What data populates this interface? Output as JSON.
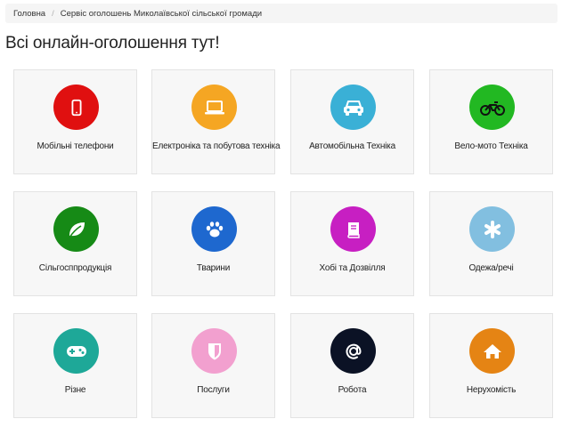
{
  "breadcrumb": {
    "home": "Головна",
    "separator": "/",
    "current": "Сервіс оголошень Миколаївської сільської громади"
  },
  "page_title": "Всі онлайн-оголошення тут!",
  "categories": [
    {
      "label": "Мобільні телефони",
      "icon": "mobile-phone-icon",
      "color": "#e01010"
    },
    {
      "label": "Електроніка та побутова техніка",
      "icon": "laptop-icon",
      "color": "#f5a623"
    },
    {
      "label": "Автомобільна Техніка",
      "icon": "car-icon",
      "color": "#3ab0d6"
    },
    {
      "label": "Вело-мото Техніка",
      "icon": "motorcycle-icon",
      "color": "#22b822"
    },
    {
      "label": "Сільгосппродукція",
      "icon": "leaf-icon",
      "color": "#168a16"
    },
    {
      "label": "Тварини",
      "icon": "paw-icon",
      "color": "#1e68cf"
    },
    {
      "label": "Хобі та Дозвілля",
      "icon": "book-icon",
      "color": "#c71fc2"
    },
    {
      "label": "Одежа/речі",
      "icon": "asterisk-icon",
      "color": "#82bfe0"
    },
    {
      "label": "Різне",
      "icon": "gamepad-icon",
      "color": "#1ea898"
    },
    {
      "label": "Послуги",
      "icon": "shield-icon",
      "color": "#f2a0cf"
    },
    {
      "label": "Робота",
      "icon": "at-sign-icon",
      "color": "#0b1225"
    },
    {
      "label": "Нерухомість",
      "icon": "home-icon",
      "color": "#e58414"
    }
  ]
}
